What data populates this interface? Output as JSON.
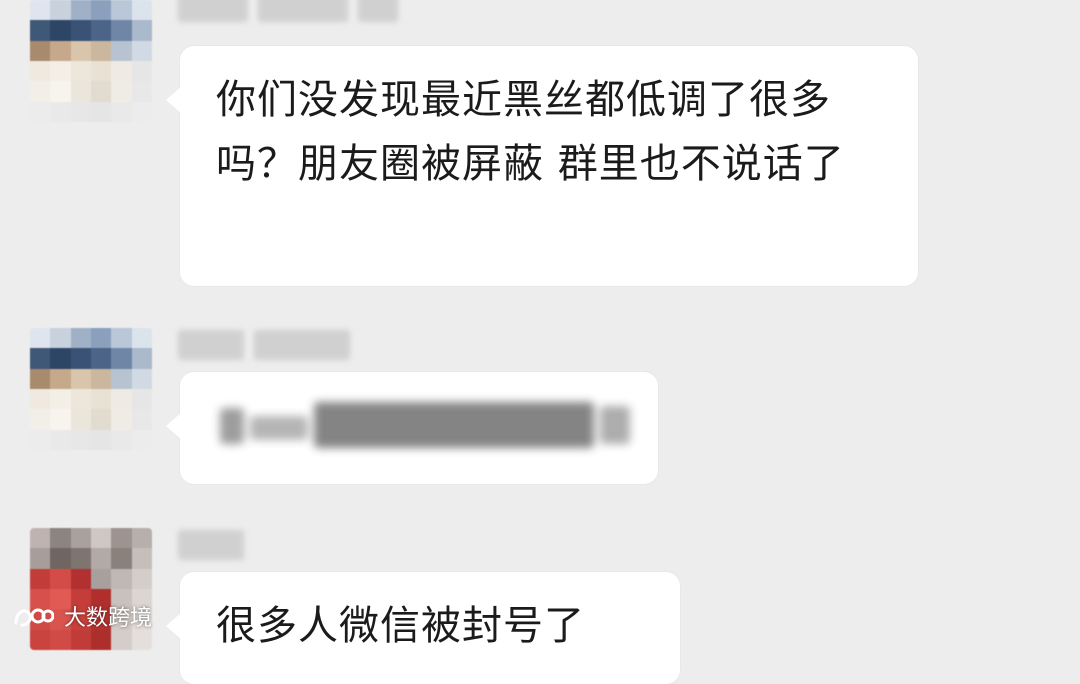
{
  "chat": {
    "messages": [
      {
        "avatar_icon": "user-avatar",
        "sender_blurred": true,
        "text": "你们没发现最近黑丝都低调了很多吗？朋友圈被屏蔽 群里也不说话了"
      },
      {
        "avatar_icon": "user-avatar",
        "sender_blurred": true,
        "text_blurred": true
      },
      {
        "avatar_icon": "user-avatar",
        "sender_blurred": true,
        "text": "很多人微信被封号了"
      }
    ]
  },
  "watermark": {
    "logo_icon": "dashu-logo-icon",
    "text": "大数跨境"
  },
  "colors": {
    "background": "#ededed",
    "bubble": "#ffffff",
    "text": "#1b1b1b"
  }
}
